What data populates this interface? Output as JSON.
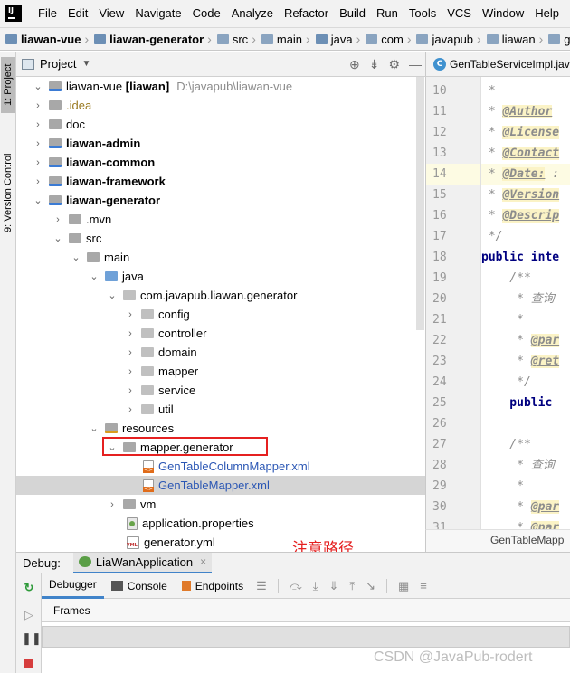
{
  "menubar": {
    "items": [
      "File",
      "Edit",
      "View",
      "Navigate",
      "Code",
      "Analyze",
      "Refactor",
      "Build",
      "Run",
      "Tools",
      "VCS",
      "Window",
      "Help"
    ]
  },
  "breadcrumb": {
    "items": [
      "liawan-vue",
      "liawan-generator",
      "src",
      "main",
      "java",
      "com",
      "javapub",
      "liawan",
      "g"
    ]
  },
  "sidebar": {
    "project_tab": "1: Project",
    "version_control_tab": "9: Version Control"
  },
  "project_panel": {
    "title": "Project",
    "tree": [
      {
        "label": "liawan-vue",
        "extra": "[liawan]",
        "path": "D:\\javapub\\liawan-vue"
      },
      {
        "label": ".idea"
      },
      {
        "label": "doc"
      },
      {
        "label": "liawan-admin"
      },
      {
        "label": "liawan-common"
      },
      {
        "label": "liawan-framework"
      },
      {
        "label": "liawan-generator"
      },
      {
        "label": ".mvn"
      },
      {
        "label": "src"
      },
      {
        "label": "main"
      },
      {
        "label": "java"
      },
      {
        "label": "com.javapub.liawan.generator"
      },
      {
        "label": "config"
      },
      {
        "label": "controller"
      },
      {
        "label": "domain"
      },
      {
        "label": "mapper"
      },
      {
        "label": "service"
      },
      {
        "label": "util"
      },
      {
        "label": "resources"
      },
      {
        "label": "mapper.generator"
      },
      {
        "label": "GenTableColumnMapper.xml"
      },
      {
        "label": "GenTableMapper.xml"
      },
      {
        "label": "vm"
      },
      {
        "label": "application.properties"
      },
      {
        "label": "generator.yml"
      }
    ]
  },
  "annotation": {
    "text": "注意路径",
    "color": "#e52020"
  },
  "editor": {
    "tab": "GenTableServiceImpl.java",
    "line_numbers": [
      "10",
      "11",
      "12",
      "13",
      "14",
      "15",
      "16",
      "17",
      "18",
      "19",
      "20",
      "21",
      "22",
      "23",
      "24",
      "25",
      "26",
      "27",
      "28",
      "29",
      "30",
      "31"
    ],
    "lines": [
      {
        "prefix": " *",
        "tag": "",
        "rest": ""
      },
      {
        "prefix": " * ",
        "tag": "@Author",
        "rest": ""
      },
      {
        "prefix": " * ",
        "tag": "@License",
        "rest": ""
      },
      {
        "prefix": " * ",
        "tag": "@Contact",
        "rest": ""
      },
      {
        "prefix": " * ",
        "tag": "@Date:",
        "rest": " :"
      },
      {
        "prefix": " * ",
        "tag": "@Version",
        "rest": ""
      },
      {
        "prefix": " * ",
        "tag": "@Descrip",
        "rest": ""
      },
      {
        "prefix": " */",
        "tag": "",
        "rest": ""
      },
      {
        "prefix": "",
        "tag": "",
        "rest": "",
        "code": "public inte"
      },
      {
        "prefix": "    /**",
        "tag": "",
        "rest": ""
      },
      {
        "prefix": "     * 查询",
        "tag": "",
        "rest": ""
      },
      {
        "prefix": "     *",
        "tag": "",
        "rest": ""
      },
      {
        "prefix": "     * ",
        "tag": "@par",
        "rest": ""
      },
      {
        "prefix": "     * ",
        "tag": "@ret",
        "rest": ""
      },
      {
        "prefix": "     */",
        "tag": "",
        "rest": ""
      },
      {
        "prefix": "",
        "tag": "",
        "rest": "",
        "code": "    public "
      },
      {
        "prefix": "",
        "tag": "",
        "rest": ""
      },
      {
        "prefix": "    /**",
        "tag": "",
        "rest": ""
      },
      {
        "prefix": "     * 查询",
        "tag": "",
        "rest": ""
      },
      {
        "prefix": "     *",
        "tag": "",
        "rest": ""
      },
      {
        "prefix": "     * ",
        "tag": "@par",
        "rest": ""
      },
      {
        "prefix": "     * ",
        "tag": "@par",
        "rest": ""
      }
    ],
    "footer": "GenTableMapp"
  },
  "debug": {
    "title": "Debug:",
    "app_tab": "LiaWanApplication",
    "tabs": [
      "Debugger",
      "Console",
      "Endpoints"
    ],
    "frames_label": "Frames"
  },
  "watermark": "CSDN @JavaPub-rodert"
}
